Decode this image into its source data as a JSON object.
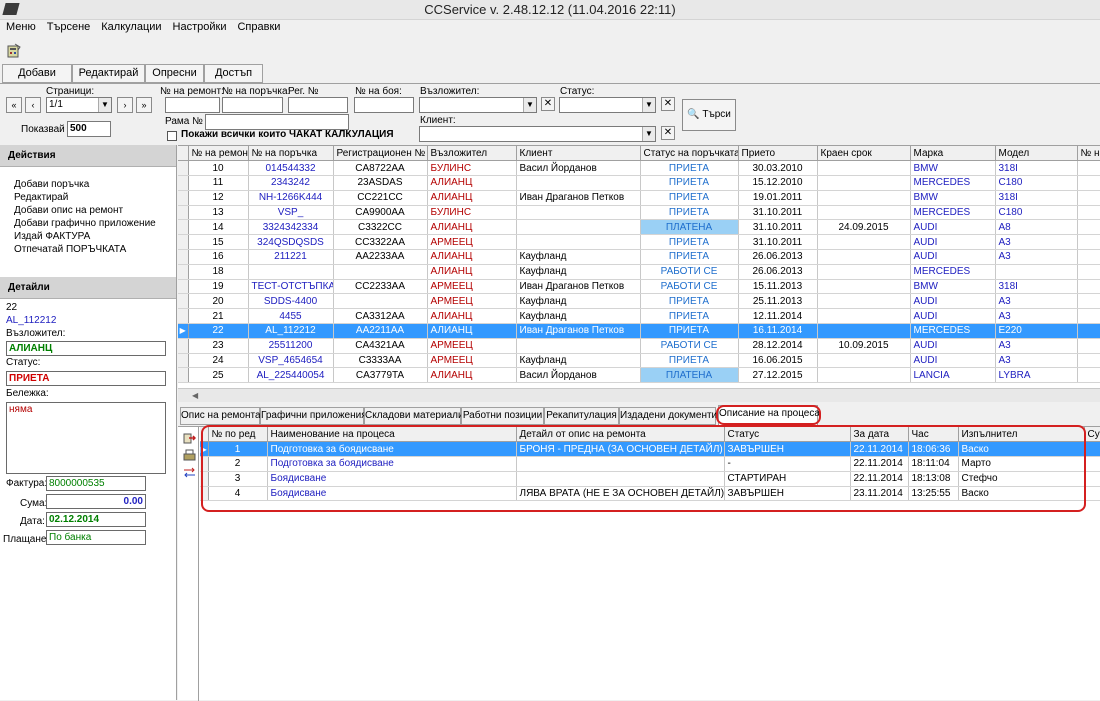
{
  "window": {
    "title": "CCService v. 2.48.12.12 (11.04.2016 22:11)"
  },
  "menu": [
    "Меню",
    "Търсене",
    "Калкулации",
    "Настройки",
    "Справки"
  ],
  "toolbar_tabs": [
    "Добави",
    "Редактирай",
    "Опресни",
    "Достъп"
  ],
  "filters": {
    "pages_label": "Страници:",
    "pages_value": "1/1",
    "show_label": "Показвай",
    "show_value": "500",
    "repair_no_label": "№ на ремонт:",
    "order_no_label": "№ на поръчка:",
    "reg_no_label": "Рег. №",
    "paint_no_label": "№ на боя:",
    "assignor_label": "Възложител:",
    "status_label": "Статус:",
    "client_label": "Клиент:",
    "frame_label": "Рама №",
    "waiting_calc_label": "Покажи всички които ЧАКАТ КАЛКУЛАЦИЯ",
    "search_button": "Търси"
  },
  "actions": {
    "header": "Действия",
    "items": [
      "Добави поръчка",
      "Редактирай",
      "Добави опис на ремонт",
      "Добави графично приложение",
      "Издай ФАКТУРА",
      "Отпечатай ПОРЪЧКАТА"
    ]
  },
  "details": {
    "header": "Детайли",
    "number": "22",
    "order": "AL_112212",
    "assignor_label": "Възложител:",
    "assignor_value": "АЛИАНЦ",
    "status_label": "Статус:",
    "status_value": "ПРИЕТА",
    "note_label": "Бележка:",
    "note_value": "няма",
    "invoice_label": "Фактура:",
    "invoice_value": "8000000535",
    "sum_label": "Сума:",
    "sum_value": "0.00",
    "date_label": "Дата:",
    "date_value": "02.12.2014",
    "payment_label": "Плащане:",
    "payment_value": "По банка"
  },
  "orders": {
    "columns": [
      "№ на ремонт",
      "№ на поръчка",
      "Регистрационен №",
      "Възложител",
      "Клиент",
      "Статус на поръчката",
      "Прието",
      "Краен срок",
      "Марка",
      "Модел",
      "№ на"
    ],
    "rows": [
      [
        "10",
        "014544332",
        "CA8722AA",
        "БУЛИНС",
        "Васил Йорданов",
        "ПРИЕТА",
        "30.03.2010",
        "",
        "BMW",
        "318I"
      ],
      [
        "11",
        "2343242",
        "23ASDAS",
        "АЛИАНЦ",
        "",
        "ПРИЕТА",
        "15.12.2010",
        "",
        "MERCEDES",
        "C180"
      ],
      [
        "12",
        "NH-1266K444",
        "CC221CC",
        "АЛИАНЦ",
        "Иван Драганов Петков",
        "ПРИЕТА",
        "19.01.2011",
        "",
        "BMW",
        "318I"
      ],
      [
        "13",
        "VSP_",
        "CA9900AA",
        "БУЛИНС",
        "",
        "ПРИЕТА",
        "31.10.2011",
        "",
        "MERCEDES",
        "C180"
      ],
      [
        "14",
        "3324342334",
        "C3322CC",
        "АЛИАНЦ",
        "",
        "ПЛАТЕНА",
        "31.10.2011",
        "24.09.2015",
        "AUDI",
        "A8"
      ],
      [
        "15",
        "324QSDQSDS",
        "CC3322AA",
        "АРМЕЕЦ",
        "",
        "ПРИЕТА",
        "31.10.2011",
        "",
        "AUDI",
        "A3"
      ],
      [
        "16",
        "211221",
        "AA2233AA",
        "АЛИАНЦ",
        "Кауфланд",
        "ПРИЕТА",
        "26.06.2013",
        "",
        "AUDI",
        "A3"
      ],
      [
        "18",
        "",
        "",
        "АЛИАНЦ",
        "Кауфланд",
        "РАБОТИ СЕ",
        "26.06.2013",
        "",
        "MERCEDES",
        ""
      ],
      [
        "19",
        "ТЕСТ-ОТСТЪПКА",
        "CC2233AA",
        "АРМЕЕЦ",
        "Иван Драганов Петков",
        "РАБОТИ СЕ",
        "15.11.2013",
        "",
        "BMW",
        "318I"
      ],
      [
        "20",
        "SDDS-4400",
        "",
        "АРМЕЕЦ",
        "Кауфланд",
        "ПРИЕТА",
        "25.11.2013",
        "",
        "AUDI",
        "A3"
      ],
      [
        "21",
        "4455",
        "CA3312AA",
        "АЛИАНЦ",
        "Кауфланд",
        "ПРИЕТА",
        "12.11.2014",
        "",
        "AUDI",
        "A3"
      ],
      [
        "22",
        "AL_112212",
        "AA2211AA",
        "АЛИАНЦ",
        "Иван Драганов Петков",
        "ПРИЕТА",
        "16.11.2014",
        "",
        "MERCEDES",
        "E220"
      ],
      [
        "23",
        "25511200",
        "CA4321AA",
        "АРМЕЕЦ",
        "",
        "РАБОТИ СЕ",
        "28.12.2014",
        "10.09.2015",
        "AUDI",
        "A3"
      ],
      [
        "24",
        "VSP_4654654",
        "C3333AA",
        "АРМЕЕЦ",
        "Кауфланд",
        "ПРИЕТА",
        "16.06.2015",
        "",
        "AUDI",
        "A3"
      ],
      [
        "25",
        "AL_225440054",
        "CA3779TA",
        "АЛИАНЦ",
        "Васил Йорданов",
        "ПЛАТЕНА",
        "27.12.2015",
        "",
        "LANCIA",
        "LYBRA"
      ]
    ]
  },
  "bottom_tabs": [
    "Опис на ремонта",
    "Графични приложения",
    "Складови материали",
    "Работни позиции",
    "Рекапитулация",
    "Издадени документи",
    "Описание на процеса"
  ],
  "process": {
    "columns": [
      "№ по ред",
      "Наименование на процеса",
      "Детайл от опис на ремонта",
      "Статус",
      "За дата",
      "Час",
      "Изпълнител",
      "Сум"
    ],
    "rows": [
      [
        "1",
        "Подготовка за боядисване",
        "БРОНЯ - ПРЕДНА (ЗА ОСНОВЕН ДЕТАЙЛ)",
        "ЗАВЪРШЕН",
        "22.11.2014",
        "18:06:36",
        "Васко"
      ],
      [
        "2",
        "Подготовка за боядисване",
        "",
        "-",
        "22.11.2014",
        "18:11:04",
        "Марто"
      ],
      [
        "3",
        "Боядисване",
        "",
        "СТАРТИРАН",
        "22.11.2014",
        "18:13:08",
        "Стефчо"
      ],
      [
        "4",
        "Боядисване",
        "ЛЯВА ВРАТА (НЕ Е ЗА ОСНОВЕН ДЕТАЙЛ)",
        "ЗАВЪРШЕН",
        "23.11.2014",
        "13:25:55",
        "Васко"
      ]
    ]
  },
  "icons": {
    "app": "car-logo-icon",
    "tool": "calculator-icon"
  },
  "colors": {
    "selection": "#3399ff",
    "status_blue": "#1e6ecd",
    "assignor_red": "#b40000",
    "highlight_box": "#d42020"
  }
}
